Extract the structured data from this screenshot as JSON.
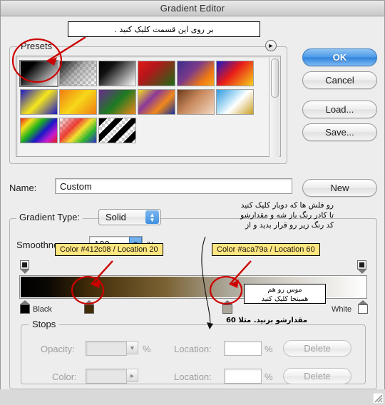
{
  "window": {
    "title": "Gradient Editor"
  },
  "presets": {
    "legend": "Presets",
    "menu_icon": "right-triangle-icon",
    "swatches": [
      {
        "name": "foreground-to-background",
        "css": "linear-gradient(135deg,#000 0%,#000 25%,#ffffff 100%)"
      },
      {
        "name": "foreground-to-transparent",
        "checker": true,
        "css": "linear-gradient(135deg,rgba(20,20,20,1) 0%,rgba(120,120,120,0.55) 45%,rgba(255,255,255,0) 100%)"
      },
      {
        "name": "black-white",
        "css": "linear-gradient(135deg,#000 0%,#111 28%,#ffffff 100%)"
      },
      {
        "name": "red-green",
        "css": "linear-gradient(135deg,#e01b18 0%,#b5161a 35%,#1d6b18 100%)"
      },
      {
        "name": "violet-orange",
        "css": "linear-gradient(135deg,#3b2d8f 0%,#7a3a8a 40%,#f07a12 75%,#f5a623 100%)"
      },
      {
        "name": "blue-red-yellow",
        "css": "linear-gradient(135deg,#1b17c8 0%,#e81b18 45%,#f7d11a 100%)"
      },
      {
        "name": "blue-yellow-blue",
        "css": "linear-gradient(135deg,#1b17c8 0%,#f5e61c 50%,#1b17c8 100%)"
      },
      {
        "name": "orange-yellow-orange",
        "css": "linear-gradient(135deg,#f07c12 0%,#f7d81a 50%,#f07c12 100%)"
      },
      {
        "name": "violet-green-orange",
        "css": "linear-gradient(135deg,#6b2a8f 0%,#1d7a22 50%,#f0881a 100%)"
      },
      {
        "name": "yellow-violet-orange-blue",
        "css": "linear-gradient(135deg,#f5e01c 0%,#8a3a9a 35%,#f0881a 65%,#14309c 100%)"
      },
      {
        "name": "copper",
        "css": "linear-gradient(135deg,#6b3b1c 0%,#c98a5e 45%,#f2d8c2 100%)"
      },
      {
        "name": "chrome",
        "css": "linear-gradient(135deg,#2f9ae0 0%,#bfe4f7 40%,#ffffff 55%,#caa023 100%)"
      },
      {
        "name": "spectrum",
        "css": "linear-gradient(135deg,#e81b18 0%,#f5e01c 20%,#1db21d 40%,#1b17c8 60%,#c51bd0 80%,#e81b18 100%)"
      },
      {
        "name": "transparent-rainbow",
        "checker": true,
        "css": "linear-gradient(135deg,rgba(255,255,255,0) 0%,rgba(236,27,24,0.85) 35%,rgba(245,224,28,0.9) 55%,rgba(29,178,29,0.9) 75%,rgba(27,23,200,0.9) 100%)"
      },
      {
        "name": "transparent-stripes",
        "checker": true,
        "css": "repeating-linear-gradient(135deg,#000 0 8px,rgba(255,255,255,0) 8px 16px)"
      }
    ]
  },
  "buttons": {
    "ok": "OK",
    "cancel": "Cancel",
    "load": "Load...",
    "save": "Save...",
    "new": "New"
  },
  "name_row": {
    "label": "Name:",
    "value": "Custom"
  },
  "gradient": {
    "type_label": "Gradient Type:",
    "type_value": "Solid",
    "smoothness_label": "Smoothness:",
    "smoothness_value": "100",
    "percent": "%",
    "bar_css": "linear-gradient(90deg,#000000 0%,#0a0704 8%,#412c08 20%,#7b6234 42%,#aca79a 60%,#d7d4cc 78%,#ffffff 100%)",
    "left_stop_label": "Black",
    "right_stop_label": "White",
    "stop_colors": {
      "left": "#000000",
      "mid1": "#412c08",
      "mid2": "#aca79a",
      "right": "#ffffff"
    }
  },
  "stops": {
    "legend": "Stops",
    "opacity_label": "Opacity:",
    "opacity_value": "",
    "opacity_location_label": "Location:",
    "opacity_location_value": "",
    "color_label": "Color:",
    "color_location_label": "Location:",
    "color_location_value": "",
    "percent": "%",
    "delete_label": "Delete"
  },
  "annotations": {
    "top_callout": "بر روی این قسمت کلیک کنید .",
    "note_left": "Color #412c08 / Location 20",
    "note_right": "Color #aca79a / Location 60",
    "fa_block": "رو فلش ها که دوبار کلیک کنید\nتا کادر رنگ باز شه  و مقدارشو\nکد رنگ زیر رو قرار بدید و از",
    "fa_mouse": "موس رو هم\nهمینجا کلیک کنید",
    "fa_value": "مقدارشو بزنید. مثلا 60",
    "highlight_color": "#cc0000",
    "note_bg": "#ffe680"
  }
}
